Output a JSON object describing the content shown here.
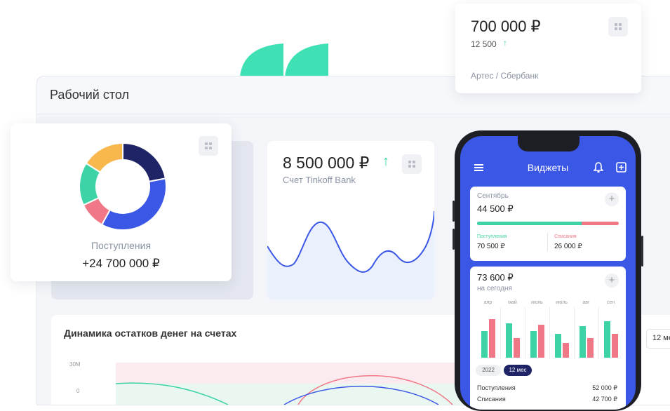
{
  "dashboard": {
    "title": "Рабочий стол",
    "section_title": "Динамика остатков денег на счетах",
    "period_btn": "12 ме",
    "y_ticks": [
      "30M",
      "0"
    ]
  },
  "top_card": {
    "amount": "700 000 ₽",
    "change": "12 500",
    "account": "Артес / Сбербанк"
  },
  "donut_card": {
    "label": "Поступления",
    "amount": "+24 700 000 ₽",
    "slices": [
      {
        "value": 22,
        "color": "#1e2466"
      },
      {
        "value": 36,
        "color": "#3b57e6"
      },
      {
        "value": 10,
        "color": "#f07886"
      },
      {
        "value": 16,
        "color": "#3ed3a6"
      },
      {
        "value": 16,
        "color": "#f8b84e"
      }
    ]
  },
  "tinkoff_card": {
    "amount": "8 500 000 ₽",
    "account": "Счет Tinkoff Bank"
  },
  "phone": {
    "title": "Виджеты",
    "month_card": {
      "month": "Сентябрь",
      "amount": "44 500 ₽",
      "in_label": "Поступления",
      "in_value": "70 500 ₽",
      "out_label": "Списания",
      "out_value": "26 000 ₽"
    },
    "today_card": {
      "amount": "73 600 ₽",
      "caption": "на сегодня",
      "months": [
        "апр",
        "май",
        "июнь",
        "июль",
        "авг",
        "сен"
      ],
      "bars": [
        {
          "green": 0.55,
          "red": 0.78
        },
        {
          "green": 0.7,
          "red": 0.4
        },
        {
          "green": 0.55,
          "red": 0.67
        },
        {
          "green": 0.48,
          "red": 0.3
        },
        {
          "green": 0.65,
          "red": 0.4
        },
        {
          "green": 0.74,
          "red": 0.48
        }
      ],
      "toggle_year": "2022",
      "toggle_period": "12 мес"
    },
    "rows": [
      {
        "label": "Поступления",
        "value": "52 000 ₽"
      },
      {
        "label": "Списания",
        "value": "42 700 ₽"
      }
    ]
  },
  "colors": {
    "accent": "#3b57e6",
    "green": "#3ed3a6",
    "red": "#f07886",
    "navy": "#1e2466",
    "yellow": "#f8b84e"
  }
}
